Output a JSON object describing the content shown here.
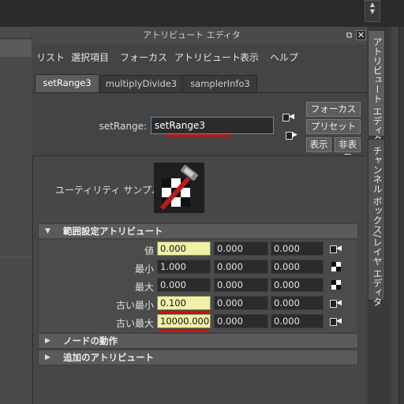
{
  "window": {
    "title": "アトリビュート エディタ",
    "float_glyph": "⧉",
    "close_glyph": "✕"
  },
  "menu": [
    "リスト",
    "選択項目",
    "フォーカス",
    "アトリビュート",
    "表示",
    "ヘルプ"
  ],
  "node_tabs": [
    "setRange3",
    "multiplyDivide3",
    "samplerInfo3"
  ],
  "active_tab": "setRange3",
  "node_name": {
    "label": "setRange:",
    "value": "setRange3"
  },
  "side_buttons": {
    "focus": "フォーカス",
    "preset": "プリセット",
    "show": "表示",
    "hide": "非表示"
  },
  "utility": {
    "label": "ユーティリティ サンプル",
    "icon": "setrange-hammer-icon"
  },
  "sections": {
    "range": "範囲設定アトリビュート",
    "node_behavior": "ノードの動作",
    "extra": "追加のアトリビュート"
  },
  "attributes": [
    {
      "label": "値",
      "values": [
        "0.000",
        "0.000",
        "0.000"
      ],
      "keyed_first": true,
      "icon": "map-connect-icon"
    },
    {
      "label": "最小",
      "values": [
        "1.000",
        "0.000",
        "0.000"
      ],
      "keyed_first": false,
      "icon": "checker-map-icon"
    },
    {
      "label": "最大",
      "values": [
        "0.000",
        "0.000",
        "0.000"
      ],
      "keyed_first": false,
      "icon": "checker-map-icon"
    },
    {
      "label": "古い最小",
      "values": [
        "0.100",
        "0.000",
        "0.000"
      ],
      "keyed_first": true,
      "icon": "map-connect-icon"
    },
    {
      "label": "古い最大",
      "values": [
        "10000.000",
        "0.000",
        "0.000"
      ],
      "keyed_first": true,
      "icon": "map-connect-icon"
    }
  ],
  "dock_tabs": [
    "アトリビュート エディタ",
    "チャンネル ボックス/レイヤ エディタ"
  ],
  "colors": {
    "highlight_underline": "#cc1010",
    "keyed_field": "#f0f0a8",
    "focus_border": "#4f8fc6"
  }
}
